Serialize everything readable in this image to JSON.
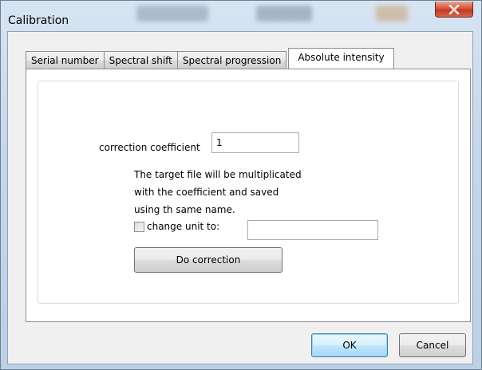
{
  "window": {
    "title": "Calibration"
  },
  "tabs": [
    {
      "label": "Serial number"
    },
    {
      "label": "Spectral shift"
    },
    {
      "label": "Spectral progression"
    },
    {
      "label": "Absolute intensity"
    }
  ],
  "absolute_intensity": {
    "coefficient_label": "correction coefficient",
    "coefficient_value": "1",
    "description_line1": "The target file will be multiplicated",
    "description_line2": "with the coefficient and saved",
    "description_line3": "using th same name.",
    "change_unit_label": "change unit to:",
    "change_unit_checked": false,
    "change_unit_value": "",
    "do_correction_label": "Do correction"
  },
  "footer": {
    "ok_label": "OK",
    "cancel_label": "Cancel"
  },
  "colors": {
    "close_button": "#c2391f",
    "default_button_border": "#3c7fb1",
    "frame": "#bcd0e6"
  },
  "icons": {
    "close": "close-icon"
  }
}
